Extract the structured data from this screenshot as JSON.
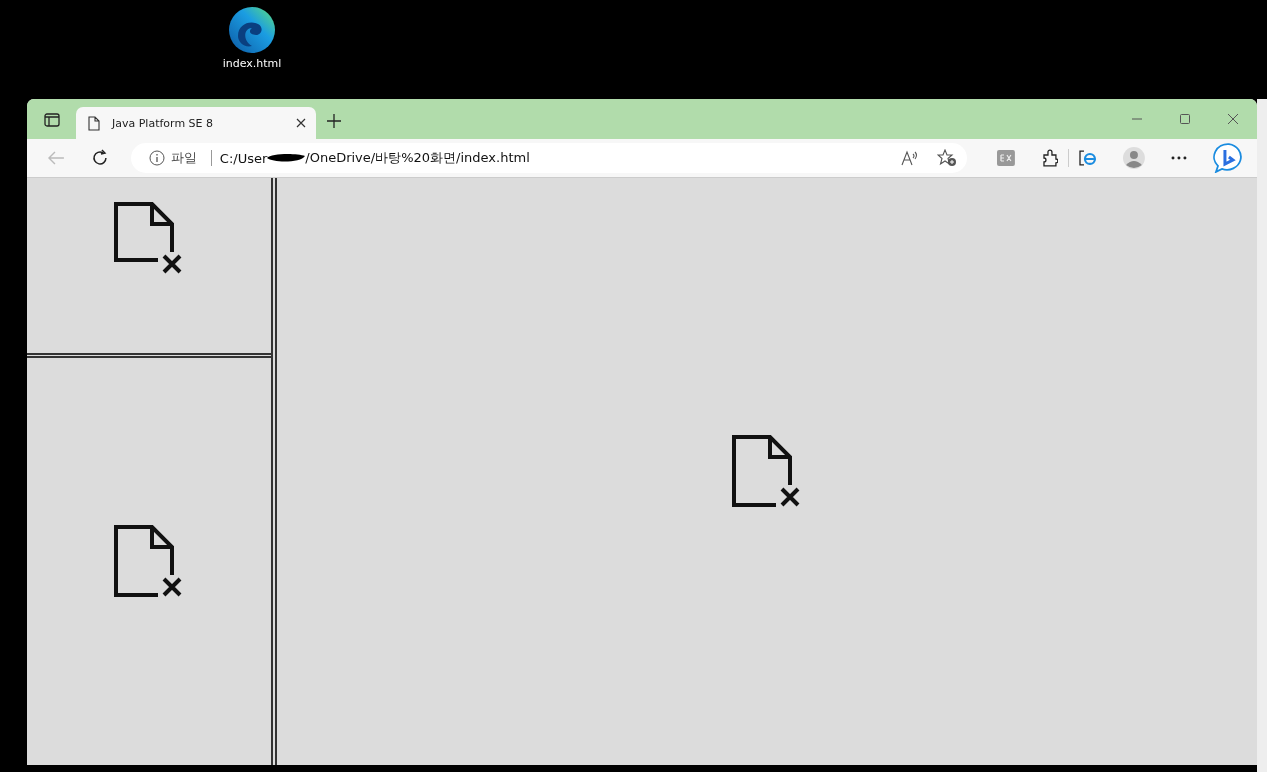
{
  "desktop_icon": {
    "label": "index.html"
  },
  "tabs": [
    {
      "title": "Java Platform SE 8",
      "selected": true
    }
  ],
  "address_bar": {
    "scheme_label": "파일",
    "url_start": "C:/User",
    "url_end": "/OneDrive/바탕%20화면/index.html"
  }
}
